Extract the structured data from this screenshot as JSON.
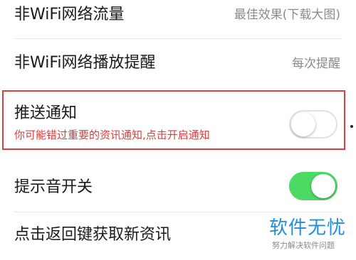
{
  "settings": {
    "wifi_traffic": {
      "label": "非WiFi网络流量",
      "value": "最佳效果(下载大图)"
    },
    "wifi_play_alert": {
      "label": "非WiFi网络播放提醒",
      "value": "每次提醒"
    },
    "push_notifications": {
      "label": "推送通知",
      "hint": "你可能错过重要的资讯通知,点击开启通知",
      "enabled": false
    },
    "notification_sound": {
      "label": "提示音开关",
      "enabled": true
    },
    "back_refresh": {
      "label": "点击返回键获取新资讯"
    }
  },
  "watermark": {
    "title": "软件无忧",
    "subtitle": "努力解决软件问题"
  },
  "colors": {
    "toggle_on": "#4cd964",
    "highlight": "#e23b3b",
    "watermark": "#1e8fe0"
  }
}
